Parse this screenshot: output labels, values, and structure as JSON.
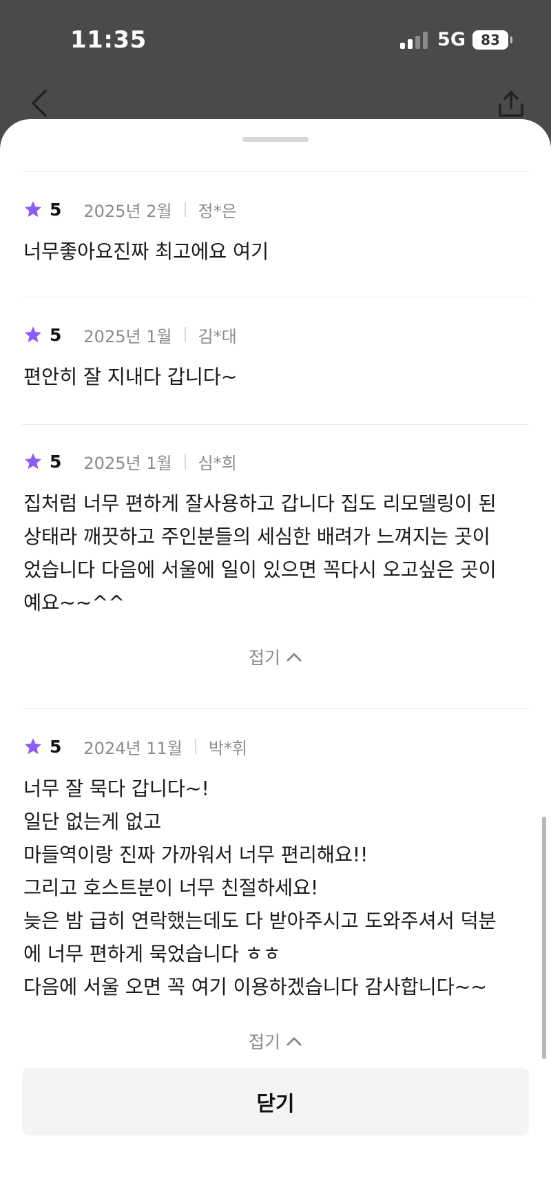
{
  "status_bar": {
    "time": "11:35",
    "network": "5G",
    "battery": "83"
  },
  "nav": {
    "back_icon": "chevron-left-icon",
    "share_icon": "share-upload-icon"
  },
  "colors": {
    "star": "#8b5cf6",
    "meta_text": "#8a8a8a"
  },
  "reviews": [
    {
      "score": "5",
      "date": "2025년 2월",
      "author": "정*은",
      "text": "너무좋아요진짜 최고에요 여기"
    },
    {
      "score": "5",
      "date": "2025년 1월",
      "author": "김*대",
      "text": "편안히 잘 지내다 갑니다~"
    },
    {
      "score": "5",
      "date": "2025년 1월",
      "author": "심*희",
      "text": "집처럼 너무 편하게 잘사용하고 갑니다 집도 리모델링이 된\n상태라 깨끗하고 주인분들의 세심한 배려가 느껴지는 곳이\n었습니다 다음에 서울에 일이 있으면 꼭다시 오고싶은 곳이\n예요~~^^"
    },
    {
      "score": "5",
      "date": "2024년 11월",
      "author": "박*휘",
      "text": "너무 잘 묵다 갑니다~!\n일단 없는게 없고\n마들역이랑 진짜 가까워서 너무 편리해요!!\n그리고 호스트분이 너무 친절하세요!\n늦은 밤 급히 연락했는데도 다 받아주시고 도와주셔서 덕분\n에 너무 편하게 묵었습니다 ㅎㅎ\n다음에 서울 오면 꼭 여기 이용하겠습니다 감사합니다~~"
    }
  ],
  "collapse_label": "접기",
  "close_button_label": "닫기"
}
